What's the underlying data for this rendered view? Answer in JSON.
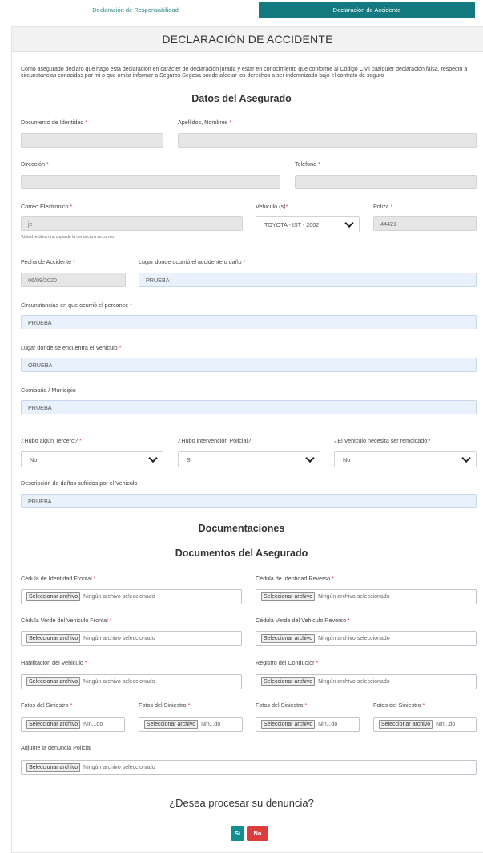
{
  "tabs": {
    "responsabilidad": "Declaración de Responsabilidad",
    "accidente": "Declaración de Accidente"
  },
  "form": {
    "title": "DECLARACIÓN DE ACCIDENTE",
    "intro": "Como asegurado declaro que hago esta declaración en carácter de declaración jurada y estar en conocimiento que conforme al Código Civil cualquier declaración falsa, respecto a circunstancias conocidas por mi o que omita informar a Seguros Segesa puede afectar los derechos a ser indemnizado bajo el contrato de seguro",
    "section_asegurado": "Datos del Asegurado",
    "required_mark": "*",
    "documento": {
      "label": "Documento de Identidad",
      "value": ""
    },
    "apellidos": {
      "label": "Apellidos, Nombres",
      "value": ""
    },
    "direccion": {
      "label": "Dirección",
      "value": ""
    },
    "telefono": {
      "label": "Teléfono",
      "value": ""
    },
    "correo": {
      "label": "Correo Electronico",
      "value": "jc",
      "hint": "*Usted recibirá una copia de la denuncia a su correo"
    },
    "vehiculo": {
      "label": "Vehiculo (s)",
      "value": "TOYOTA - IST - 2002"
    },
    "poliza": {
      "label": "Poliza",
      "value": "44421"
    },
    "fecha": {
      "label": "Fecha de Accidente",
      "value": "06/09/2020"
    },
    "lugar_accidente": {
      "label": "Lugar donde ocurrió el accidente o daño",
      "value": "PRUEBA"
    },
    "circunstancias": {
      "label": "Circunstancias en que ocurrió el percance",
      "value": "PRUEBA"
    },
    "lugar_vehiculo": {
      "label": "Lugar donde se encuentra el Vehiculo",
      "value": "ORUEBA"
    },
    "comisaria": {
      "label": "Comisaria / Municipio",
      "value": "PRUEBA"
    },
    "tercero": {
      "label": "¿Hubo algún Tercero?",
      "value": "No"
    },
    "policial": {
      "label": "¿Hubo intervención Policial?",
      "value": "Si"
    },
    "remolcado": {
      "label": "¿El Vehiculo necesita ser remolcado?",
      "value": "No"
    },
    "danos": {
      "label": "Descripción de daños sufridos por el Vehiculo",
      "value": "PRUEBA"
    }
  },
  "documents": {
    "section_doc": "Documentaciones",
    "section_docs_asegurado": "Documentos del Asegurado",
    "file_button": "Seleccionar archivo",
    "no_file": "Ningún archivo seleccionado",
    "no_file_short": "Nin...do",
    "ci_frontal": "Cédula de Identidad Frontal",
    "ci_reverso": "Cédula de Identidad Reverso",
    "cv_frontal": "Cédula Verde del Vehiculo Frontal",
    "cv_reverso": "Cédula Verde del Vehiculo Reverso",
    "habilitacion": "Habilitación del Vehiculo",
    "registro": "Registro del Conductor",
    "fotos": "Fotos del Siniestro",
    "denuncia": "Adjunte la denuncia Policial"
  },
  "confirm": {
    "question": "¿Desea procesar su denuncia?",
    "yes": "Si",
    "no": "No"
  }
}
